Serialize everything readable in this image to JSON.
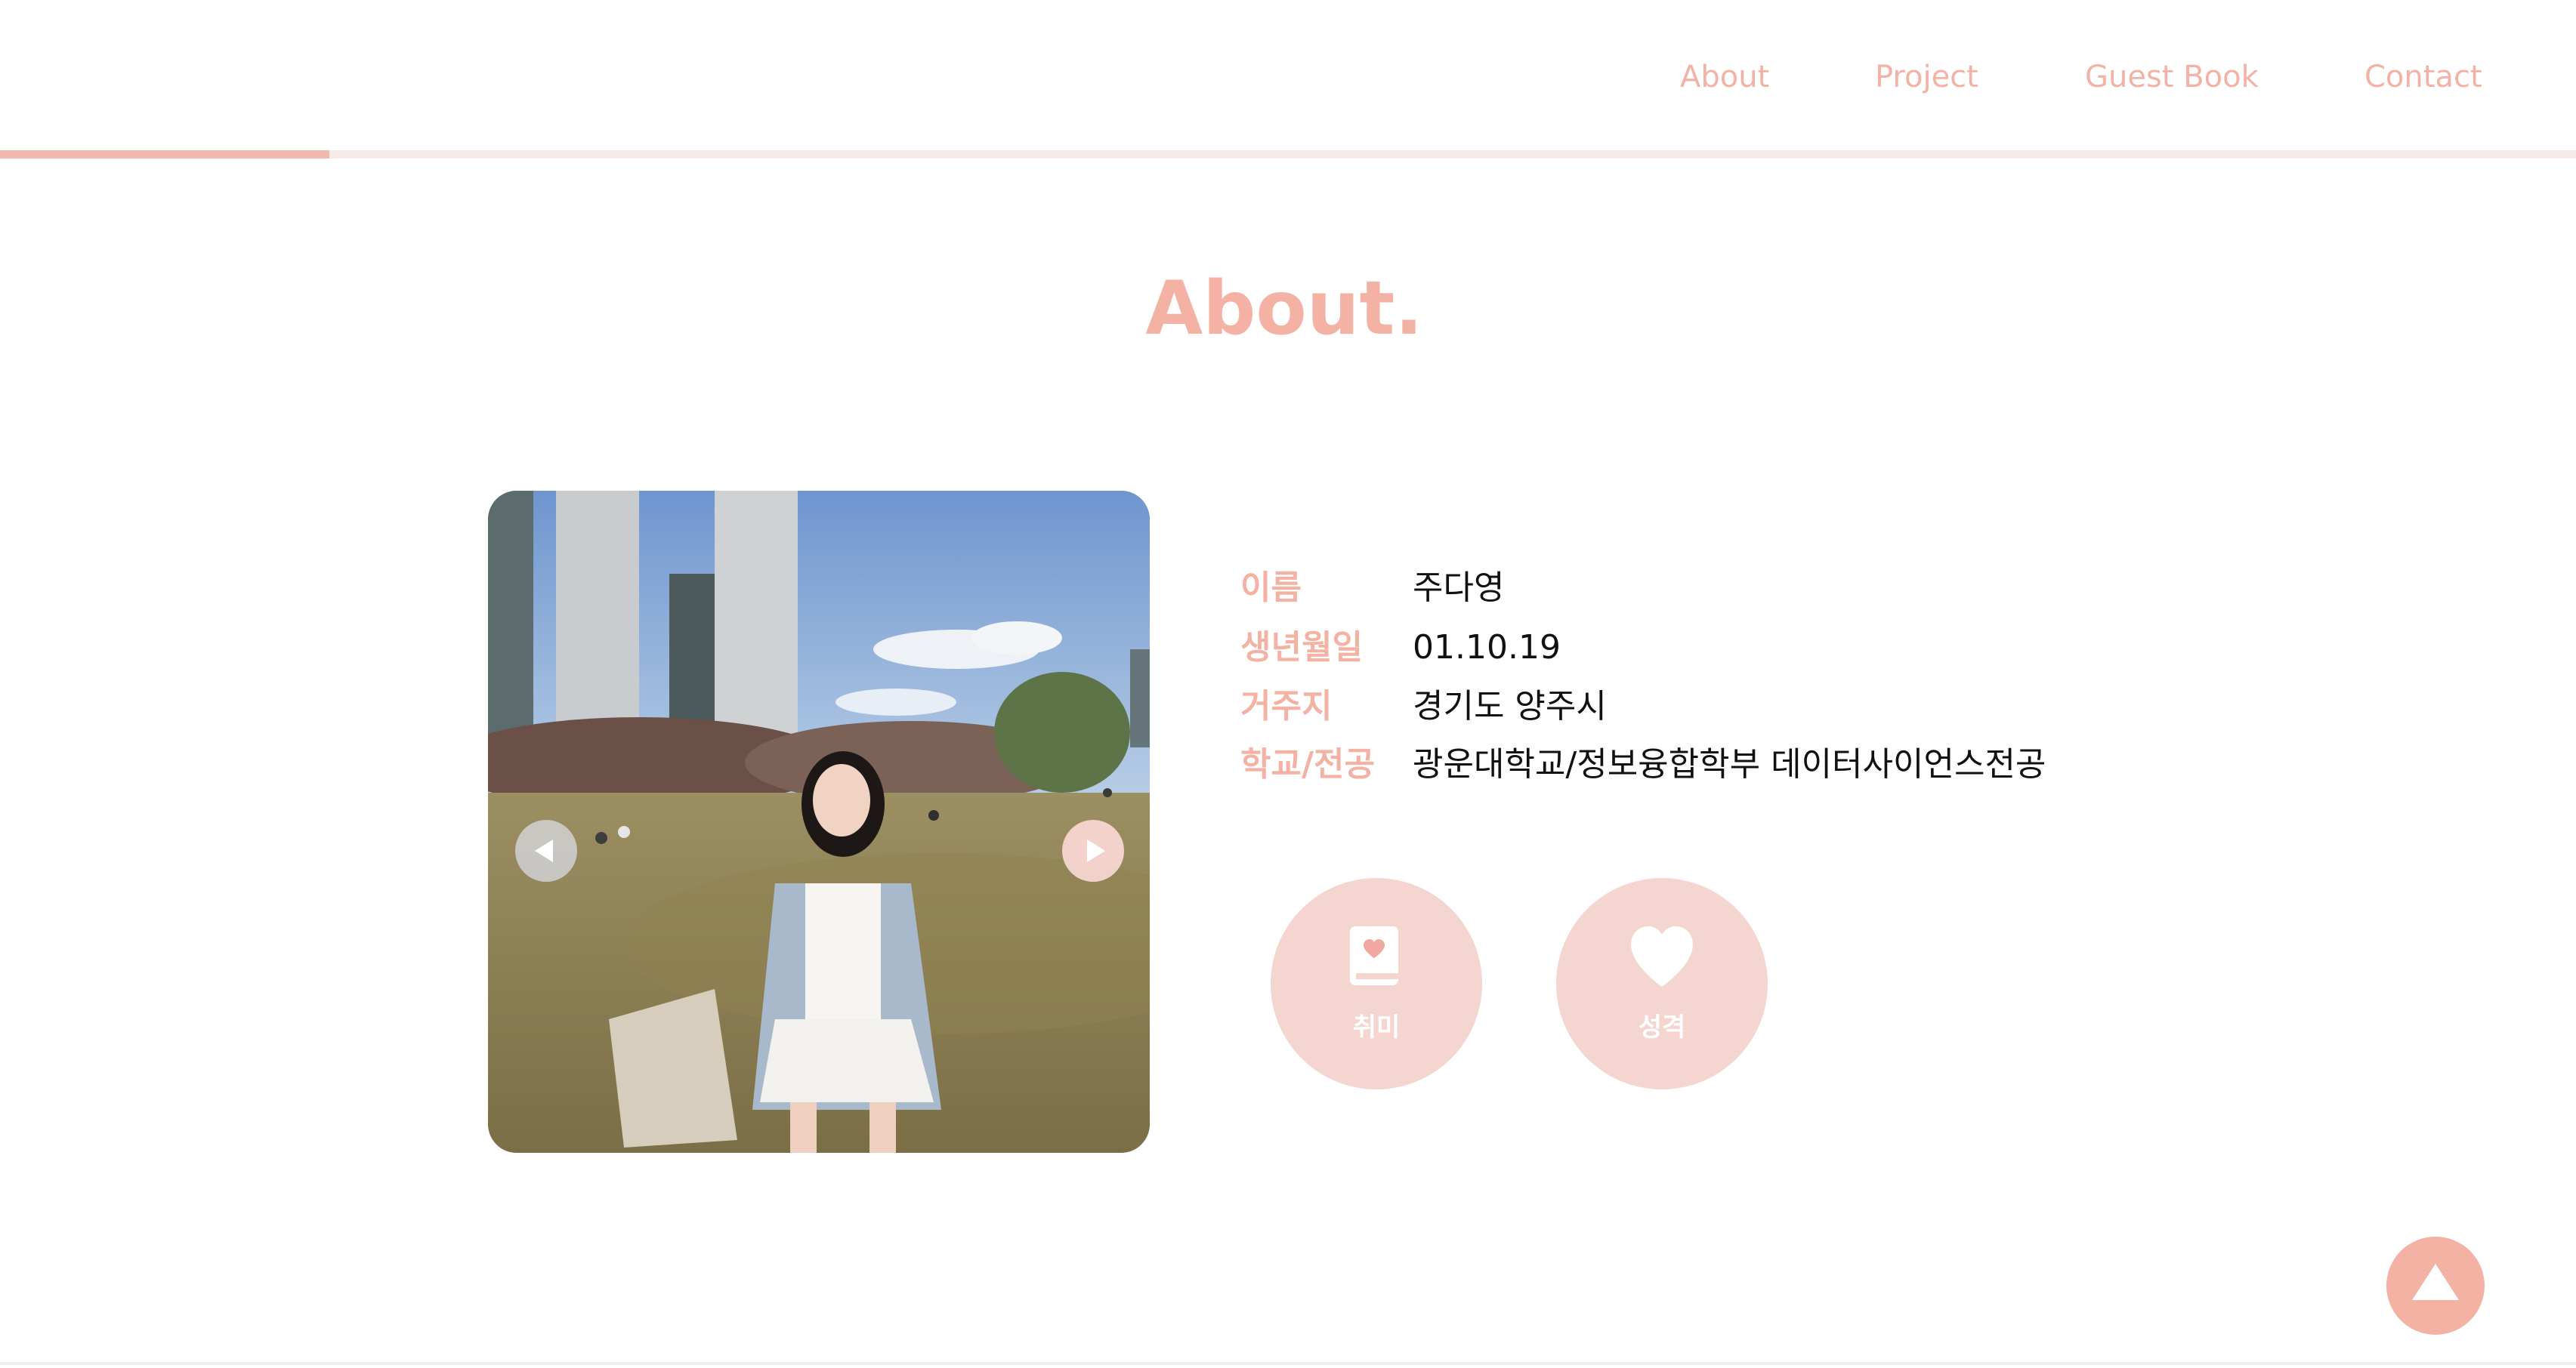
{
  "nav": {
    "links": [
      "About",
      "Project",
      "Guest Book",
      "Contact"
    ],
    "scroll_progress": 0.128
  },
  "about": {
    "title": "About.",
    "profile": [
      {
        "label": "이름",
        "value": "주다영"
      },
      {
        "label": "생년월일",
        "value": "01.10.19"
      },
      {
        "label": "거주지",
        "value": "경기도 양주시"
      },
      {
        "label": "학교/전공",
        "value": "광운대학교/정보융합학부 데이터사이언스전공"
      }
    ],
    "buttons": [
      {
        "label": "취미",
        "icon": "book-heart-icon"
      },
      {
        "label": "성격",
        "icon": "heart-icon"
      }
    ]
  },
  "colors": {
    "accent": "#f3b2a4",
    "circle": "#f5d5d0",
    "track": "#f7ebe8"
  }
}
